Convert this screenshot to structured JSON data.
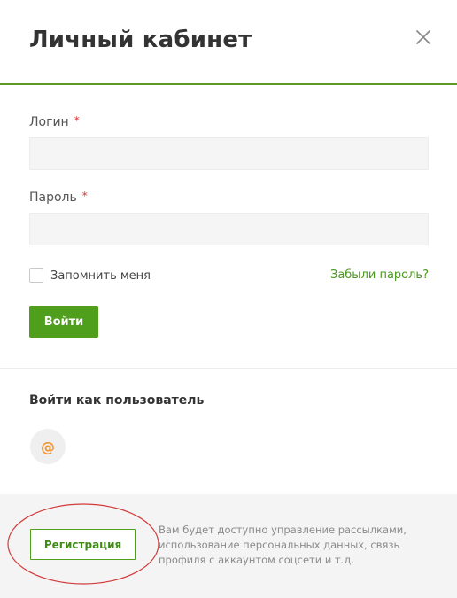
{
  "header": {
    "title": "Личный кабинет",
    "close_icon": "close-icon"
  },
  "form": {
    "login_label": "Логин",
    "password_label": "Пароль",
    "required_mark": "*",
    "login_value": "",
    "password_value": "",
    "remember_label": "Запомнить меня",
    "remember_checked": false,
    "forgot_link": "Забыли пароль?",
    "submit_label": "Войти"
  },
  "social": {
    "title": "Войти как пользователь",
    "providers": [
      {
        "icon": "at-sign-icon",
        "glyph": "@",
        "color": "#f0922b"
      }
    ]
  },
  "footer": {
    "register_label": "Регистрация",
    "hint": "Вам будет доступно управление рассылками, использование персональных данных, связь профиля с аккаунтом соцсети и т.д."
  },
  "colors": {
    "accent": "#4f9e1c",
    "header_border": "#5a9a25",
    "required": "#e0312b",
    "annotation_circle": "#d23b3b",
    "footer_bg": "#f4f4f4"
  }
}
